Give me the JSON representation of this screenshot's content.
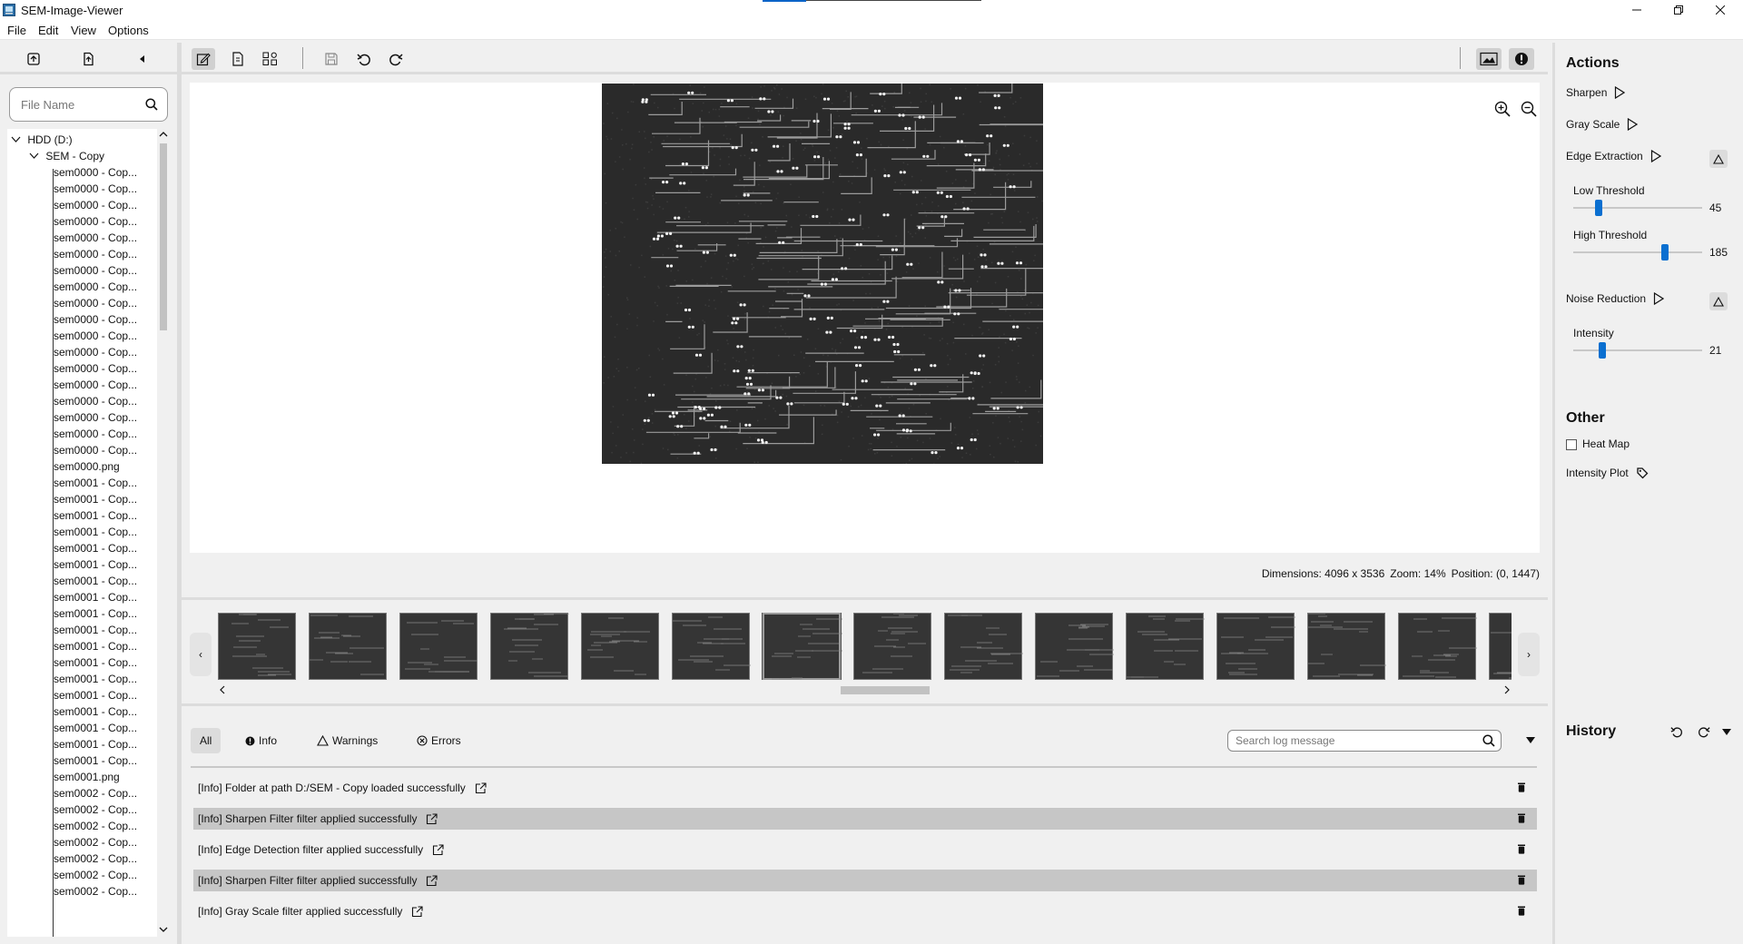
{
  "window": {
    "title": "SEM-Image-Viewer"
  },
  "menu": {
    "items": [
      "File",
      "Edit",
      "View",
      "Options"
    ]
  },
  "file_panel": {
    "search_placeholder": "File Name",
    "tree": {
      "root": "HDD (D:)",
      "folder": "SEM - Copy",
      "files": [
        "sem0000 - Cop...",
        "sem0000 - Cop...",
        "sem0000 - Cop...",
        "sem0000 - Cop...",
        "sem0000 - Cop...",
        "sem0000 - Cop...",
        "sem0000 - Cop...",
        "sem0000 - Cop...",
        "sem0000 - Cop...",
        "sem0000 - Cop...",
        "sem0000 - Cop...",
        "sem0000 - Cop...",
        "sem0000 - Cop...",
        "sem0000 - Cop...",
        "sem0000 - Cop...",
        "sem0000 - Cop...",
        "sem0000 - Cop...",
        "sem0000 - Cop...",
        "sem0000.png",
        "sem0001 - Cop...",
        "sem0001 - Cop...",
        "sem0001 - Cop...",
        "sem0001 - Cop...",
        "sem0001 - Cop...",
        "sem0001 - Cop...",
        "sem0001 - Cop...",
        "sem0001 - Cop...",
        "sem0001 - Cop...",
        "sem0001 - Cop...",
        "sem0001 - Cop...",
        "sem0001 - Cop...",
        "sem0001 - Cop...",
        "sem0001 - Cop...",
        "sem0001 - Cop...",
        "sem0001 - Cop...",
        "sem0001 - Cop...",
        "sem0001 - Cop...",
        "sem0001.png",
        "sem0002 - Cop...",
        "sem0002 - Cop...",
        "sem0002 - Cop...",
        "sem0002 - Cop...",
        "sem0002 - Cop...",
        "sem0002 - Cop...",
        "sem0002 - Cop..."
      ]
    }
  },
  "viewer": {
    "info": {
      "dimensions": "Dimensions: 4096 x 3536",
      "zoom": "Zoom: 14%",
      "position": "Position: (0, 1447)"
    }
  },
  "filmstrip": {
    "thumbnail_count": 15,
    "selected_index": 6
  },
  "log": {
    "tabs": [
      {
        "label": "All",
        "active": true
      },
      {
        "label": "Info",
        "icon": "info-icon"
      },
      {
        "label": "Warnings",
        "icon": "warning-icon"
      },
      {
        "label": "Errors",
        "icon": "error-icon"
      }
    ],
    "search_placeholder": "Search log message",
    "entries": [
      "[Info] Folder at path D:/SEM - Copy loaded successfully",
      "[Info] Sharpen Filter filter applied successfully",
      "[Info] Edge Detection filter applied successfully",
      "[Info] Sharpen Filter filter applied successfully",
      "[Info] Gray Scale filter applied successfully"
    ]
  },
  "actions": {
    "title": "Actions",
    "sharpen": "Sharpen",
    "gray_scale": "Gray Scale",
    "edge_extraction": "Edge Extraction",
    "low_threshold_label": "Low Threshold",
    "low_threshold_value": "45",
    "high_threshold_label": "High Threshold",
    "high_threshold_value": "185",
    "noise_reduction": "Noise Reduction",
    "intensity_label": "Intensity",
    "intensity_value": "21"
  },
  "other": {
    "title": "Other",
    "heat_map": "Heat Map",
    "heat_map_checked": false,
    "intensity_plot": "Intensity Plot"
  },
  "history": {
    "title": "History"
  },
  "colors": {
    "accent": "#0a6fd0",
    "image_bg": "#2a2a2a",
    "panel": "#f0f0f0"
  }
}
